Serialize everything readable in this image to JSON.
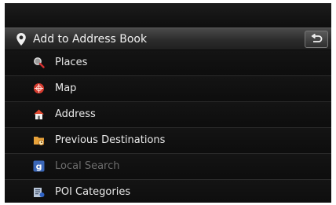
{
  "header": {
    "title": "Add to Address Book",
    "icon": "location-pin-icon",
    "back_icon": "back-arrow-icon"
  },
  "menu": {
    "items": [
      {
        "label": "Places",
        "icon": "magnifier-icon",
        "enabled": true
      },
      {
        "label": "Map",
        "icon": "map-target-icon",
        "enabled": true
      },
      {
        "label": "Address",
        "icon": "house-icon",
        "enabled": true
      },
      {
        "label": "Previous Destinations",
        "icon": "folder-clock-icon",
        "enabled": true
      },
      {
        "label": "Local Search",
        "icon": "google-icon",
        "enabled": false
      },
      {
        "label": "POI Categories",
        "icon": "poi-categories-icon",
        "enabled": true
      }
    ]
  },
  "colors": {
    "text": "#e9e9e9",
    "disabled_text": "#6d6d6d",
    "background": "#101010"
  }
}
